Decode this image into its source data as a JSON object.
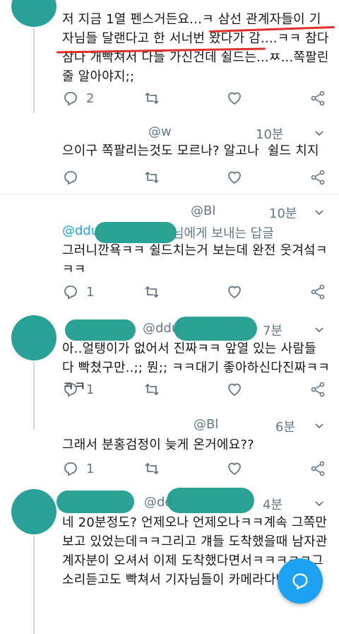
{
  "tweets": [
    {
      "text": "저 지금 1열 펜스거든요...ㅋ 삼선 관계자들이 기자님들 달랜다고 한 서너번 왔다가 감....ㅋㅋ 참다참다 개빡쳐서 다들 가신건데 쉴드는...ㅉ...쪽팔린줄 알아야지;;",
      "reply_count": "2"
    },
    {
      "handle": "@w",
      "time": "10분",
      "text": "으이구 쪽팔리는것도 모르나? 알고나  쉴드 치지"
    },
    {
      "handle": "@Bl",
      "time": "10분",
      "reply_prefix": "@ddu",
      "reply_suffix": "님에게 보내는 답글",
      "text": "그러니깐욕ㅋㅋ 쉴드치는거 보는데 완전 웃겨섴ㅋㅋㅋ",
      "reply_count": "1"
    },
    {
      "handle": "@ddu",
      "time": "7분",
      "text": "아..얼탱이가 없어서 진짜ㅋㅋ 앞열 있는 사람들 다 빡쳤구만..;; 뭔;; ㅋㅋ대기 좋아하신다진짜ㅋㅋㅋㅋ",
      "reply_count": "1"
    },
    {
      "handle": "@Bl",
      "time": "6분",
      "text": "그래서 분홍검정이 늦게 온거에요??",
      "reply_count": "1"
    },
    {
      "handle": "@dd",
      "time": "4분",
      "text": "네 20분정도? 언제오나 언제오나ㅋㅋ계속 그쪽만 보고 있었는데ㅋㅋ그리고 걔들 도착했을때 남자관계자분이 오셔서 이제 도착했다면서ㅋㅋㅋㅋㅋ그 소리듣고도 빡쳐서 기자님들이 카메라다빡ㅋ ㅋ"
    }
  ],
  "icons": {
    "reply": "reply-icon",
    "retweet": "retweet-icon",
    "like": "heart-icon",
    "share": "share-icon",
    "chevron": "chevron-down-icon",
    "compose": "compose-reply-icon"
  },
  "colors": {
    "accent": "#1da1f2",
    "muted": "#657786",
    "annotation": "#e0302a"
  }
}
